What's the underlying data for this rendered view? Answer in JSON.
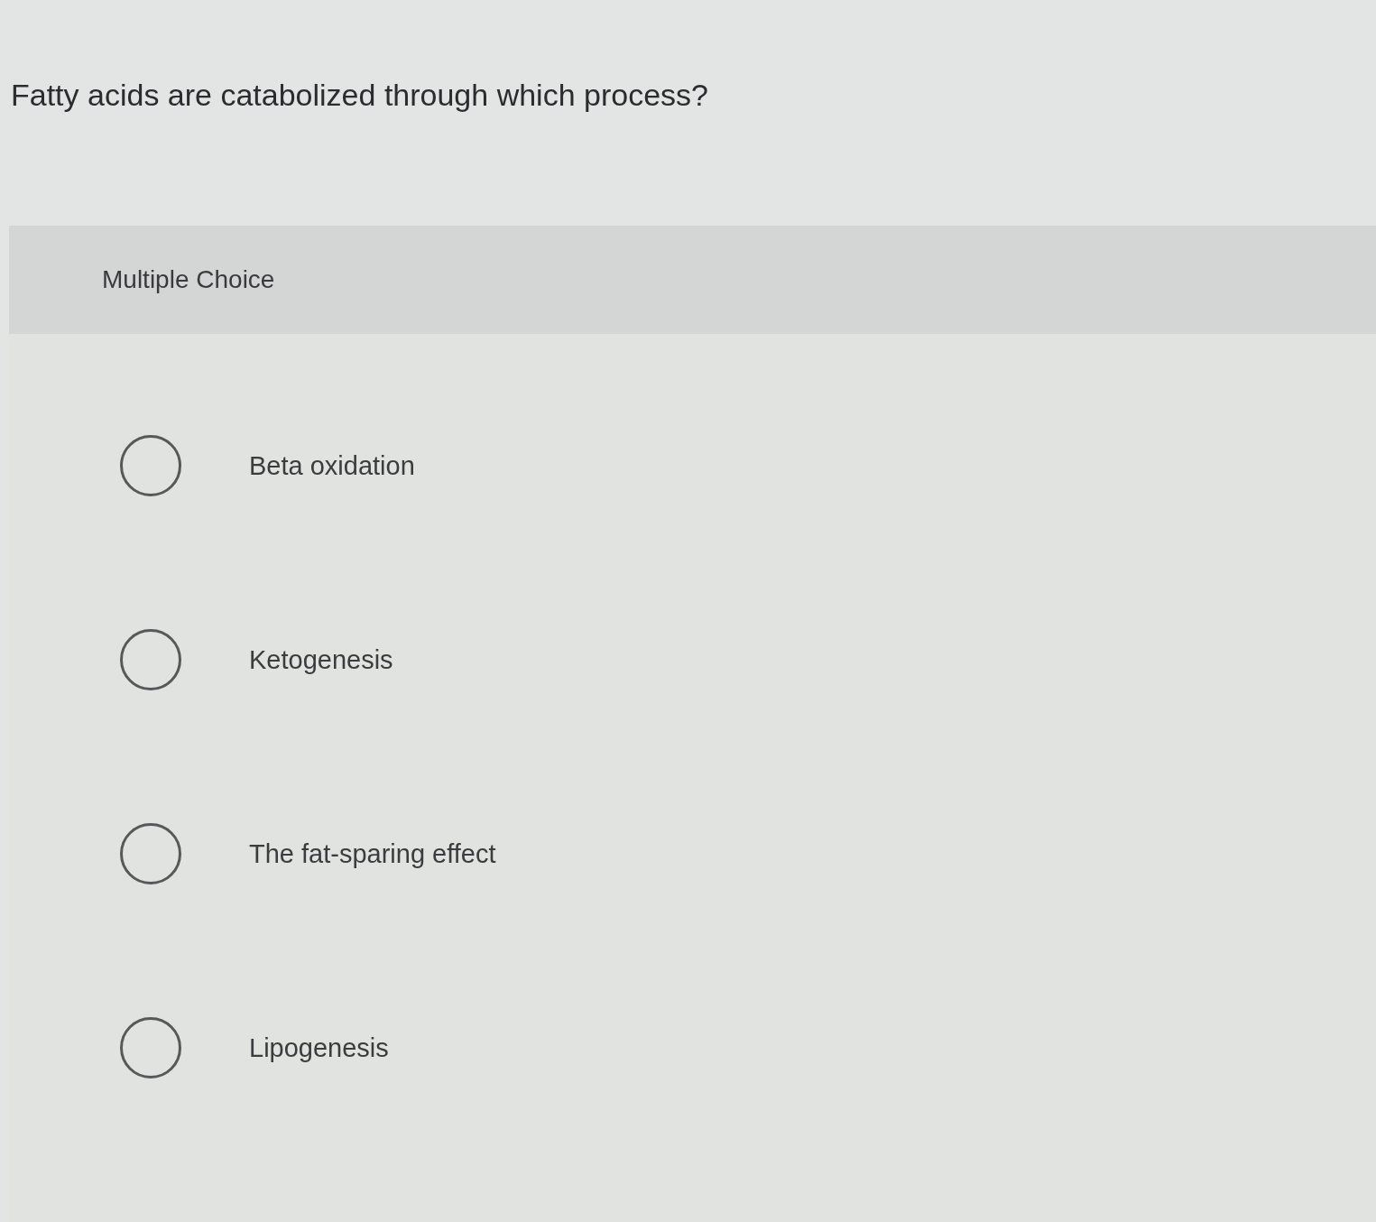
{
  "question": {
    "text": "Fatty acids are catabolized through which process?"
  },
  "answer_panel": {
    "title": "Multiple Choice",
    "options": [
      {
        "label": "Beta oxidation",
        "selected": false
      },
      {
        "label": "Ketogenesis",
        "selected": false
      },
      {
        "label": "The fat-sparing effect",
        "selected": false
      },
      {
        "label": "Lipogenesis",
        "selected": false
      }
    ]
  }
}
